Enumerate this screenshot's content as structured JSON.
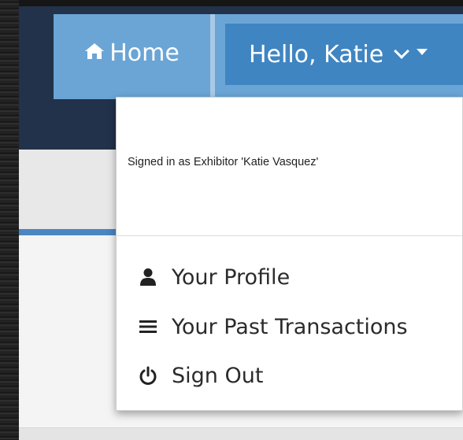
{
  "navbar": {
    "home_label": "Home",
    "user_greeting": "Hello, Katie"
  },
  "dropdown": {
    "signed_in_text": "Signed in as Exhibitor 'Katie Vasquez'",
    "items": [
      {
        "label": "Your Profile",
        "icon": "user-icon"
      },
      {
        "label": "Your Past Transactions",
        "icon": "bars-icon"
      },
      {
        "label": "Sign Out",
        "icon": "power-icon"
      }
    ]
  },
  "colors": {
    "navbar_bg": "#22324a",
    "nav_link_bg": "#6aa5d6",
    "nav_active_bg": "#3f85c2",
    "accent_line": "#4a86c0"
  }
}
